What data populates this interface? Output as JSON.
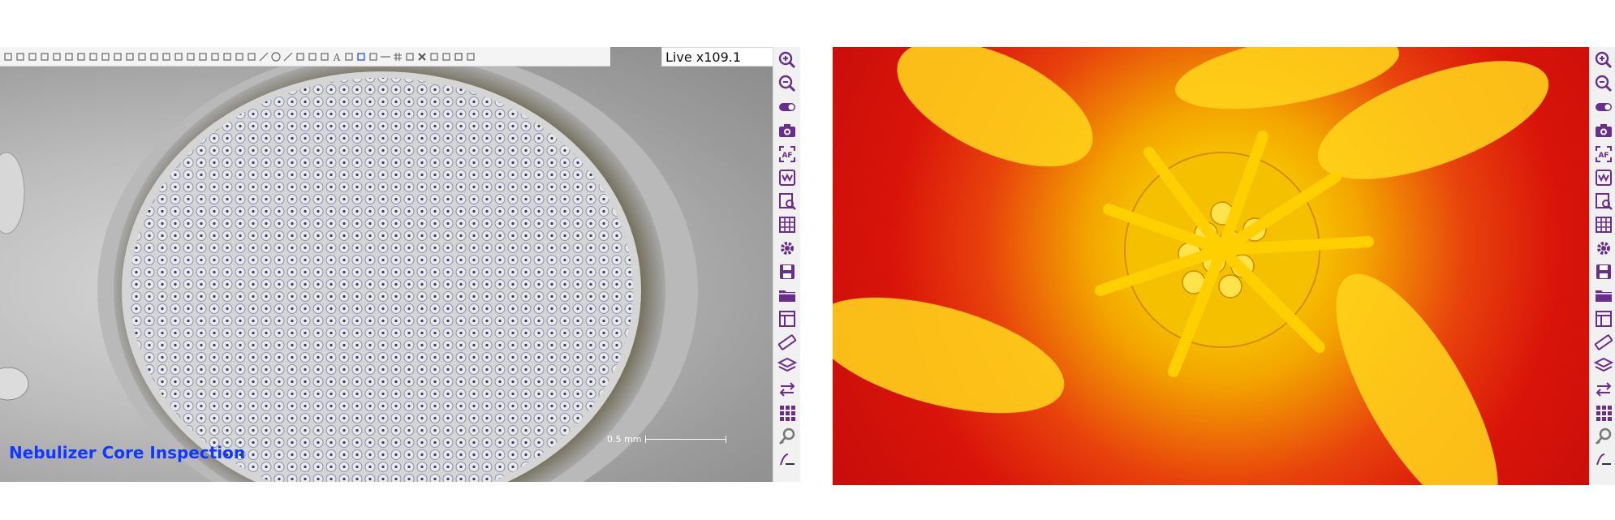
{
  "left_view": {
    "toolbar_icons": [
      "settings-icon",
      "document-icon",
      "list-icon",
      "magic-select-icon",
      "magic-wand-icon",
      "brush-icon",
      "crop-icon",
      "hand-icon",
      "pointer-icon",
      "horizontal-measure-icon",
      "vertical-measure-icon",
      "corner-icon",
      "angle-icon",
      "circle-measure-icon",
      "circle-center-icon",
      "grid-small-icon",
      "marker-icon",
      "stair-icon",
      "triangle-icon",
      "polygon-icon",
      "arc-icon",
      "line-icon",
      "circle-icon",
      "slash-icon",
      "columns-icon",
      "split-icon",
      "node-icon",
      "text-icon",
      "text-size-icon",
      "pen-color-icon",
      "dropdown-icon",
      "line-style-icon",
      "hash-icon",
      "crosshair-icon",
      "close-icon",
      "copy-icon",
      "paste-icon",
      "trash-icon",
      "refresh-icon"
    ],
    "live_zoom_label": "Live x109.1",
    "caption": "Nebulizer Core Inspection",
    "scale_label": "0.5 mm"
  },
  "sidebar_icons": [
    "zoom-in-icon",
    "zoom-out-icon",
    "toggle-icon",
    "camera-icon",
    "autofocus-icon",
    "white-balance-icon",
    "preview-icon",
    "grid-icon",
    "gear-icon",
    "save-icon",
    "folder-icon",
    "layout-icon",
    "ruler-icon",
    "layers-icon",
    "swap-icon",
    "dots-grid-icon",
    "key-icon",
    "brand-logo-icon"
  ],
  "colors": {
    "accent": "#6a2d8f",
    "caption_blue": "#1138ff"
  }
}
